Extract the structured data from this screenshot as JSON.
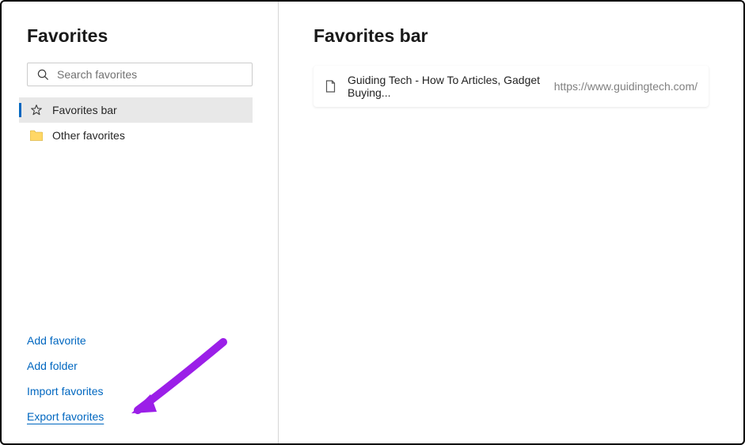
{
  "sidebar": {
    "title": "Favorites",
    "search_placeholder": "Search favorites",
    "folders": [
      {
        "label": "Favorites bar",
        "icon": "star",
        "selected": true
      },
      {
        "label": "Other favorites",
        "icon": "folder",
        "selected": false
      }
    ],
    "actions": {
      "add_favorite": "Add favorite",
      "add_folder": "Add folder",
      "import_favorites": "Import favorites",
      "export_favorites": "Export favorites"
    }
  },
  "main": {
    "title": "Favorites bar",
    "bookmarks": [
      {
        "title": "Guiding Tech - How To Articles, Gadget Buying...",
        "url": "https://www.guidingtech.com/"
      }
    ]
  },
  "annotation": {
    "arrow_color": "#9b1fe8"
  }
}
